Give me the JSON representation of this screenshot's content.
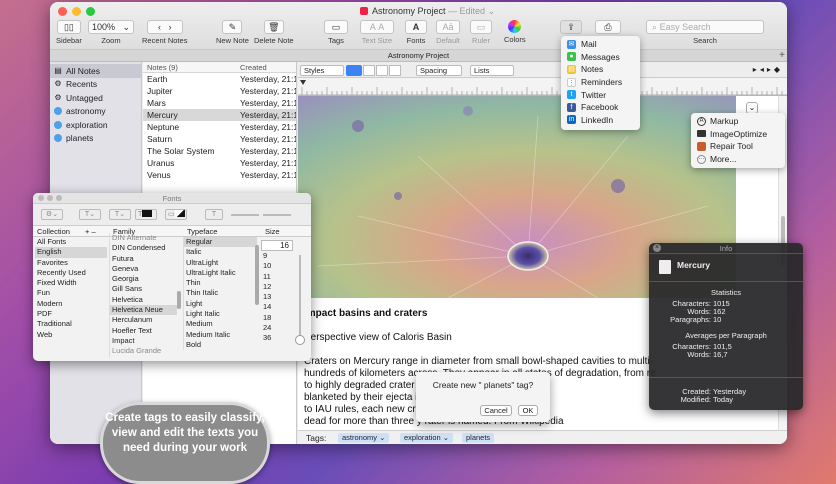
{
  "window": {
    "title": "Astronomy Project",
    "edited": "— Edited ⌄",
    "tab": "Astronomy Project"
  },
  "toolbar": {
    "sidebar": "Sidebar",
    "zoom_value": "100%",
    "zoom": "Zoom",
    "recent": "Recent Notes",
    "new_note": "New Note",
    "delete_note": "Delete Note",
    "tags": "Tags",
    "text_size": "Text Size",
    "fonts": "Fonts",
    "default": "Default",
    "ruler": "Ruler",
    "colors": "Colors",
    "search_placeholder": "Easy Search",
    "search": "Search"
  },
  "sidebar": {
    "items": [
      {
        "label": "All Notes",
        "icon": "notes-icon"
      },
      {
        "label": "Recents",
        "icon": "gear-icon"
      },
      {
        "label": "Untagged",
        "icon": "gear-icon"
      },
      {
        "label": "astronomy",
        "icon": "tag-icon"
      },
      {
        "label": "exploration",
        "icon": "tag-icon"
      },
      {
        "label": "planets",
        "icon": "tag-icon"
      }
    ]
  },
  "notes_list": {
    "col_notes": "Notes (9)",
    "col_created": "Created",
    "rows": [
      {
        "name": "Earth",
        "created": "Yesterday, 21:1"
      },
      {
        "name": "Jupiter",
        "created": "Yesterday, 21:1"
      },
      {
        "name": "Mars",
        "created": "Yesterday, 21:1"
      },
      {
        "name": "Mercury",
        "created": "Yesterday, 21:1"
      },
      {
        "name": "Neptune",
        "created": "Yesterday, 21:1"
      },
      {
        "name": "Saturn",
        "created": "Yesterday, 21:1"
      },
      {
        "name": "The Solar System",
        "created": "Yesterday, 21:1"
      },
      {
        "name": "Uranus",
        "created": "Yesterday, 21:1"
      },
      {
        "name": "Venus",
        "created": "Yesterday, 21:1"
      }
    ]
  },
  "format_bar": {
    "styles": "Styles",
    "spacing": "Spacing",
    "lists": "Lists"
  },
  "editor": {
    "heading": "Impact basins and craters",
    "subheading": "Perspective view of Caloris Basin",
    "lines": [
      "Craters on Mercury range in diameter from small bowl-shaped cavities to multi-",
      "hundreds of kilometers across. They appear in all states of degradation, from re",
      "to highly degraded crater                                       fer from lunar cr",
      "blanketed by their ejecta is                                    of Mercury's stronger",
      "to IAU rules, each new cra                                     ist that was famous fo",
      "dead for more than three y                                     rater is named. From Wikipedia"
    ],
    "tags_label": "Tags:",
    "tags": [
      "astronomy ⌄",
      "exploration ⌄",
      "planets"
    ]
  },
  "fonts_panel": {
    "title": "Fonts",
    "collection_header": "Collection",
    "family_header": "Family",
    "typeface_header": "Typeface",
    "size_header": "Size",
    "size_value": "16",
    "collections": [
      "All Fonts",
      "English",
      "Favorites",
      "Recently Used",
      "Fixed Width",
      "Fun",
      "Modern",
      "PDF",
      "Traditional",
      "Web"
    ],
    "families": [
      "DIN Alternate",
      "DIN Condensed",
      "Futura",
      "Geneva",
      "Georgia",
      "Gill Sans",
      "Helvetica",
      "Helvetica Neue",
      "Herculanum",
      "Hoefler Text",
      "Impact",
      "Lucida Grande"
    ],
    "typefaces": [
      "Regular",
      "Italic",
      "UltraLight",
      "UltraLight Italic",
      "Thin",
      "Thin Italic",
      "Light",
      "Light Italic",
      "Medium",
      "Medium Italic",
      "Bold"
    ],
    "sizes": [
      "9",
      "10",
      "11",
      "12",
      "13",
      "14",
      "18",
      "24",
      "36"
    ]
  },
  "share_menu": {
    "items": [
      {
        "label": "Mail",
        "color": "#3a8ee6"
      },
      {
        "label": "Messages",
        "color": "#38c24a"
      },
      {
        "label": "Notes",
        "color": "#f2c230"
      },
      {
        "label": "Reminders",
        "color": "#ffffff"
      },
      {
        "label": "Twitter",
        "color": "#1da1f2"
      },
      {
        "label": "Facebook",
        "color": "#3b5998"
      },
      {
        "label": "LinkedIn",
        "color": "#0a66c2"
      }
    ]
  },
  "markup_menu": {
    "items": [
      "Markup",
      "ImageOptimize",
      "Repair Tool",
      "More..."
    ]
  },
  "info_panel": {
    "title": "Info",
    "note_name": "Mercury",
    "statistics_header": "Statistics",
    "characters_label": "Characters:",
    "characters": "1015",
    "words_label": "Words:",
    "words": "162",
    "paragraphs_label": "Paragraphs:",
    "paragraphs": "10",
    "avg_header": "Averages per Paragraph",
    "avg_characters": "101,5",
    "avg_words": "16,7",
    "created_label": "Created:",
    "created": "Yesterday",
    "modified_label": "Modified:",
    "modified": "Today"
  },
  "tag_dialog": {
    "prompt": "Create new \" planets\" tag?",
    "cancel": "Cancel",
    "ok": "OK"
  },
  "promo": {
    "text": "Create tags to easily classify, view and edit the texts you need during your work"
  }
}
